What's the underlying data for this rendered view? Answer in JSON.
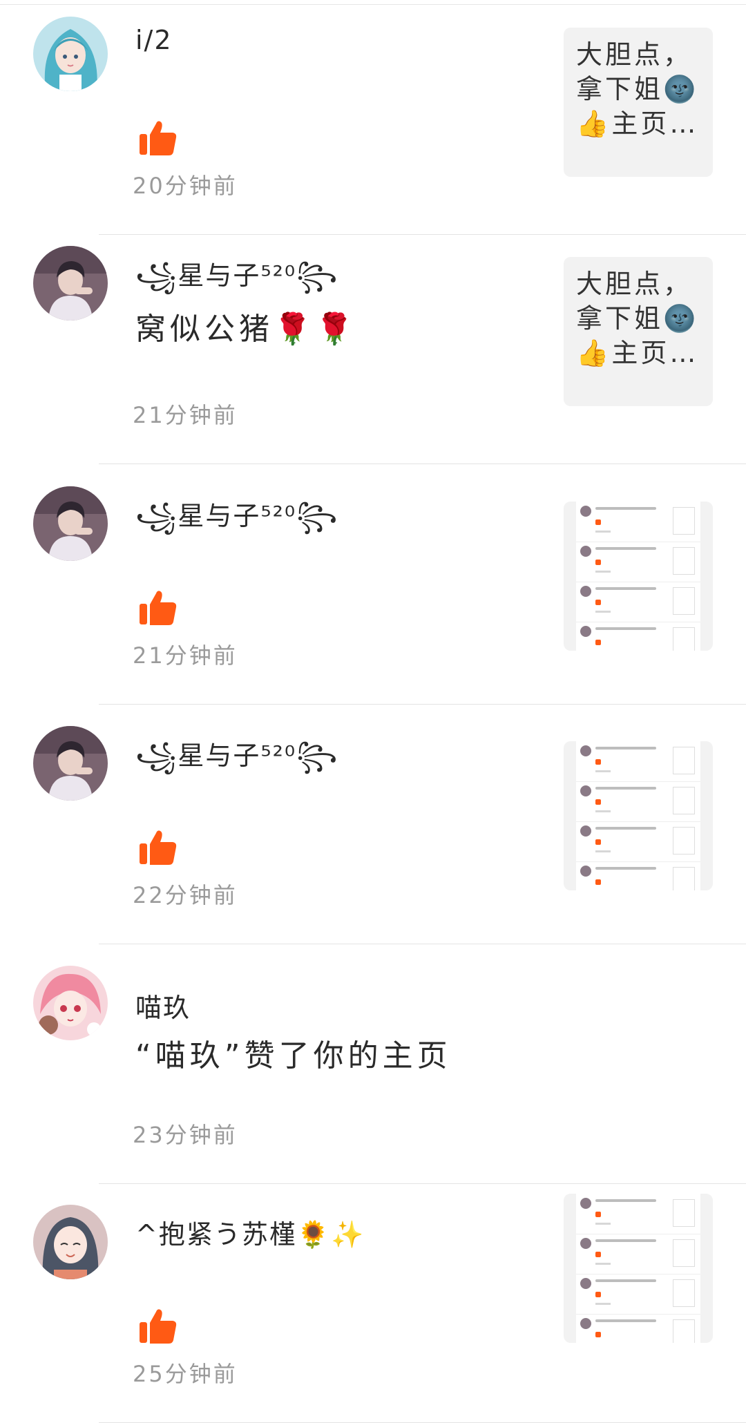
{
  "notifications": [
    {
      "avatar": "teal-haired-anime-girl-avatar",
      "name": "i/2",
      "message": "",
      "liked": true,
      "time": "20分钟前",
      "thumbnail": {
        "type": "text",
        "text": "大胆点，拿下姐🌚👍主页…"
      }
    },
    {
      "avatar": "dark-haired-boy-avatar",
      "name": "꧁星与子⁵²⁰꧂",
      "message": "窝似公猪🌹🌹",
      "liked": false,
      "time": "21分钟前",
      "thumbnail": {
        "type": "text",
        "text": "大胆点，拿下姐🌚👍主页…"
      }
    },
    {
      "avatar": "dark-haired-boy-avatar",
      "name": "꧁星与子⁵²⁰꧂",
      "message": "",
      "liked": true,
      "time": "21分钟前",
      "thumbnail": {
        "type": "screenshot"
      }
    },
    {
      "avatar": "dark-haired-boy-avatar",
      "name": "꧁星与子⁵²⁰꧂",
      "message": "",
      "liked": true,
      "time": "22分钟前",
      "thumbnail": {
        "type": "screenshot"
      }
    },
    {
      "avatar": "pink-haired-anime-girl-avatar",
      "name": "喵玖",
      "message": "“喵玖”赞了你的主页",
      "liked": false,
      "time": "23分钟前",
      "thumbnail": null
    },
    {
      "avatar": "gray-haired-anime-girl-avatar",
      "name": "^抱紧う苏槿🌻✨",
      "message": "",
      "liked": true,
      "time": "25分钟前",
      "thumbnail": {
        "type": "screenshot"
      }
    }
  ],
  "colors": {
    "like": "#ff5a14",
    "time": "#9a9a9a",
    "divider": "#e3e3e3",
    "thumb_bg": "#f2f2f2"
  },
  "icons": {
    "like": "thumbs-up-icon"
  }
}
